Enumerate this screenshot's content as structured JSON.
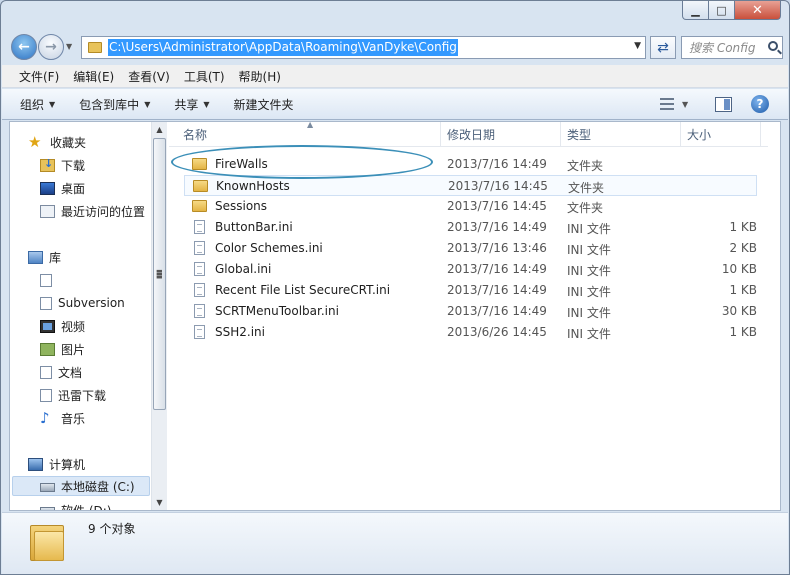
{
  "address": {
    "path": "C:\\Users\\Administrator\\AppData\\Roaming\\VanDyke\\Config"
  },
  "search": {
    "placeholder": "搜索 Config"
  },
  "menubar": [
    "文件(F)",
    "编辑(E)",
    "查看(V)",
    "工具(T)",
    "帮助(H)"
  ],
  "commands": {
    "organize": "组织",
    "include_in_library": "包含到库中",
    "share": "共享",
    "new_folder": "新建文件夹"
  },
  "nav": {
    "favorites": "收藏夹",
    "downloads": "下载",
    "desktop": "桌面",
    "recent": "最近访问的位置",
    "libraries": "库",
    "lib_subversion": "Subversion",
    "lib_video": "视频",
    "lib_pictures": "图片",
    "lib_docs": "文档",
    "lib_xunlei": "迅雷下载",
    "lib_music": "音乐",
    "computer": "计算机",
    "drive_c": "本地磁盘 (C:)",
    "drive_d": "软件 (D:)"
  },
  "columns": {
    "name": "名称",
    "date": "修改日期",
    "type": "类型",
    "size": "大小"
  },
  "files": [
    {
      "name": "FireWalls",
      "date": "2013/7/16 14:49",
      "type": "文件夹",
      "size": "",
      "icon": "folder"
    },
    {
      "name": "KnownHosts",
      "date": "2013/7/16 14:45",
      "type": "文件夹",
      "size": "",
      "icon": "folder"
    },
    {
      "name": "Sessions",
      "date": "2013/7/16 14:45",
      "type": "文件夹",
      "size": "",
      "icon": "folder"
    },
    {
      "name": "ButtonBar.ini",
      "date": "2013/7/16 14:49",
      "type": "INI 文件",
      "size": "1 KB",
      "icon": "ini"
    },
    {
      "name": "Color Schemes.ini",
      "date": "2013/7/16 13:46",
      "type": "INI 文件",
      "size": "2 KB",
      "icon": "ini"
    },
    {
      "name": "Global.ini",
      "date": "2013/7/16 14:49",
      "type": "INI 文件",
      "size": "10 KB",
      "icon": "ini"
    },
    {
      "name": "Recent File List SecureCRT.ini",
      "date": "2013/7/16 14:49",
      "type": "INI 文件",
      "size": "1 KB",
      "icon": "ini"
    },
    {
      "name": "SCRTMenuToolbar.ini",
      "date": "2013/7/16 14:49",
      "type": "INI 文件",
      "size": "30 KB",
      "icon": "ini"
    },
    {
      "name": "SSH2.ini",
      "date": "2013/6/26 14:45",
      "type": "INI 文件",
      "size": "1 KB",
      "icon": "ini"
    }
  ],
  "status": {
    "count": "9 个对象"
  },
  "colors": {
    "selection": "#3399ff",
    "highlight_ring": "#3b8fb8",
    "chrome": "#d8e4f1"
  }
}
